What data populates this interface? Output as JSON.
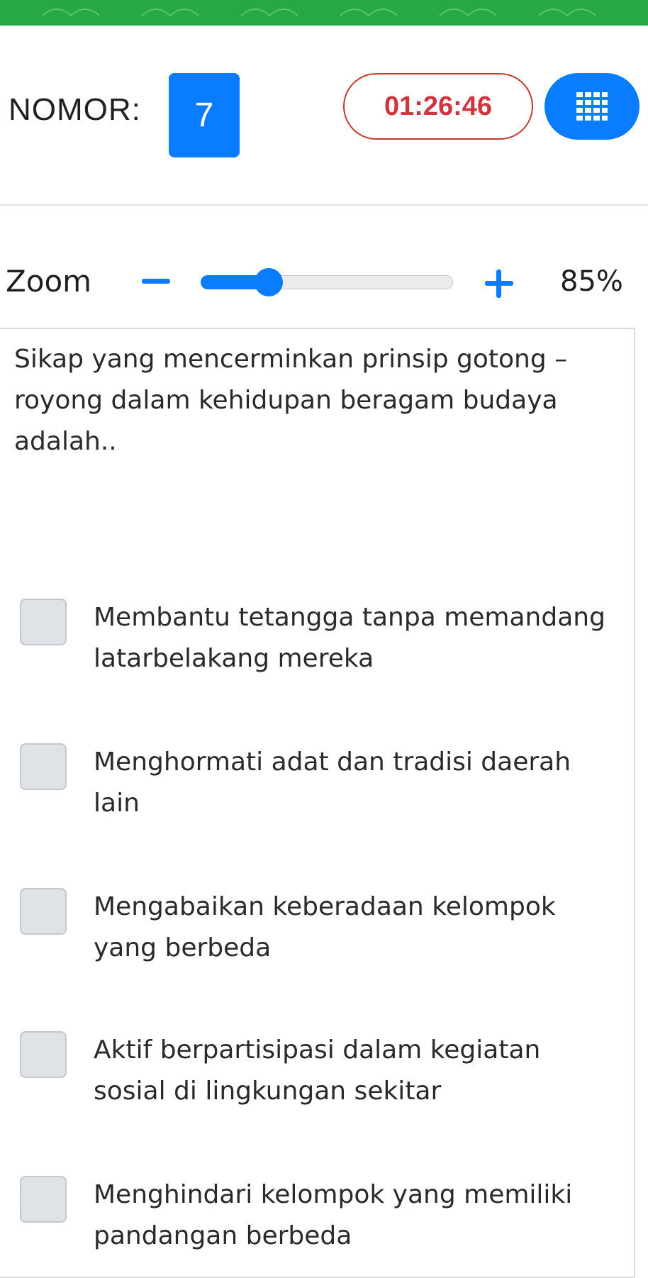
{
  "header": {
    "number_label": "NOMOR:",
    "number_value": "7",
    "timer": "01:26:46",
    "grid_button_icon": "grid-icon"
  },
  "zoom": {
    "label": "Zoom",
    "value_text": "85%",
    "level": 0.27,
    "minus_icon": "minus-icon",
    "plus_icon": "plus-icon"
  },
  "question": {
    "text": "Sikap yang mencerminkan prinsip gotong – royong dalam kehidupan beragam budaya adalah.."
  },
  "options": [
    {
      "label": "Membantu tetangga tanpa memandang latarbelakang mereka",
      "checked": false
    },
    {
      "label": "Menghormati adat dan tradisi daerah lain",
      "checked": false
    },
    {
      "label": "Mengabaikan keberadaan kelompok yang berbeda",
      "checked": false
    },
    {
      "label": "Aktif berpartisipasi dalam kegiatan sosial di lingkungan sekitar",
      "checked": false
    },
    {
      "label": "Menghindari kelompok yang memiliki pandangan berbeda",
      "checked": false
    }
  ],
  "colors": {
    "accent": "#0a7cff",
    "timer_red": "#d0343f",
    "top_bar_green": "#28a745"
  }
}
